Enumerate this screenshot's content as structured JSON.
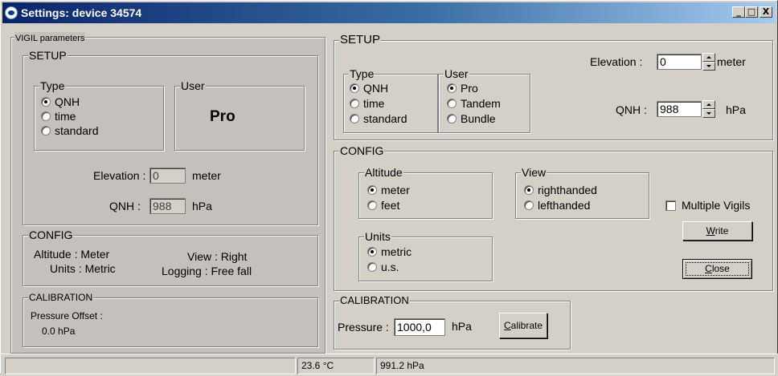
{
  "window": {
    "title": "Settings: device 34574",
    "controls": {
      "minimize": "_",
      "maximize": "□",
      "close": "X"
    }
  },
  "vigil": {
    "legend": "VIGIL parameters",
    "setup": {
      "legend": "SETUP",
      "type_legend": "Type",
      "type_options": [
        "QNH",
        "time",
        "standard"
      ],
      "type_selected": "QNH",
      "user_legend": "User",
      "user_value": "Pro",
      "elevation_label": "Elevation :",
      "elevation_value": "0",
      "elevation_unit": "meter",
      "qnh_label": "QNH :",
      "qnh_value": "988",
      "qnh_unit": "hPa"
    },
    "config": {
      "legend": "CONFIG",
      "altitude": "Altitude : Meter",
      "units": "Units : Metric",
      "view": "View : Right",
      "logging": "Logging : Free fall"
    },
    "calibration": {
      "legend": "CALIBRATION",
      "label": "Pressure Offset :",
      "value": "0.0  hPa"
    }
  },
  "setup": {
    "legend": "SETUP",
    "type_legend": "Type",
    "type_options": [
      "QNH",
      "time",
      "standard"
    ],
    "type_selected": "QNH",
    "user_legend": "User",
    "user_options": [
      "Pro",
      "Tandem",
      "Bundle"
    ],
    "user_selected": "Pro",
    "elevation_label": "Elevation :",
    "elevation_value": "0",
    "elevation_unit": "meter",
    "qnh_label": "QNH :",
    "qnh_value": "988",
    "qnh_unit": "hPa"
  },
  "config": {
    "legend": "CONFIG",
    "altitude_legend": "Altitude",
    "altitude_options": [
      "meter",
      "feet"
    ],
    "altitude_selected": "meter",
    "view_legend": "View",
    "view_options": [
      "righthanded",
      "lefthanded"
    ],
    "view_selected": "righthanded",
    "units_legend": "Units",
    "units_options": [
      "metric",
      "u.s."
    ],
    "units_selected": "metric",
    "multiple_vigils_label": "Multiple Vigils",
    "multiple_vigils_checked": false,
    "write_label": "Write",
    "write_mnemonic": "W",
    "close_label": "Close",
    "close_mnemonic": "C"
  },
  "calibration": {
    "legend": "CALIBRATION",
    "pressure_label": "Pressure :",
    "pressure_value": "1000,0",
    "pressure_unit": "hPa",
    "calibrate_label": "Calibrate",
    "calibrate_mnemonic": "C"
  },
  "statusbar": {
    "empty": "",
    "temperature": "23.6 °C",
    "pressure": "991.2 hPa"
  }
}
